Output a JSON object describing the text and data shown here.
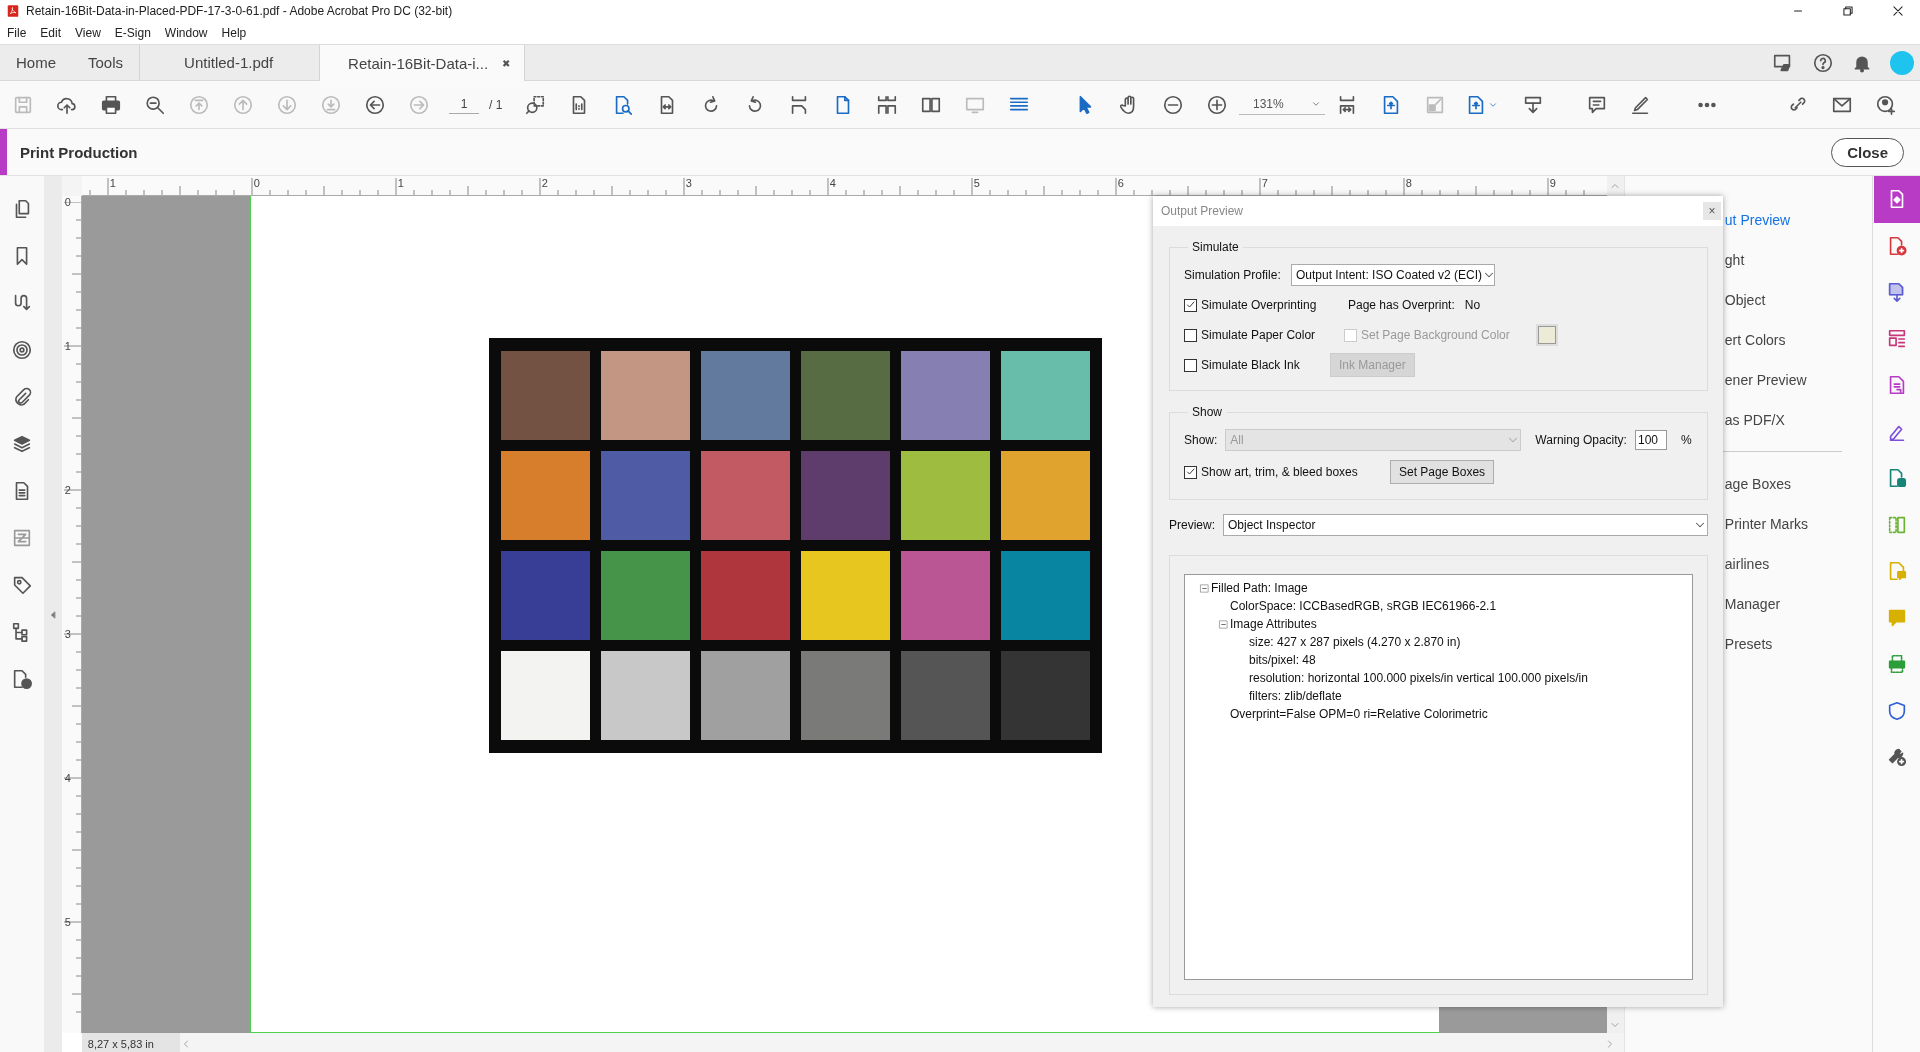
{
  "window": {
    "title": "Retain-16Bit-Data-in-Placed-PDF-17-3-0-61.pdf - Adobe Acrobat Pro DC (32-bit)"
  },
  "menu": [
    "File",
    "Edit",
    "View",
    "E-Sign",
    "Window",
    "Help"
  ],
  "tabs": [
    {
      "label": "Home",
      "selected": false,
      "kind": "nav"
    },
    {
      "label": "Tools",
      "selected": false,
      "kind": "nav"
    },
    {
      "label": "Untitled-1.pdf",
      "selected": false,
      "kind": "doc"
    },
    {
      "label": "Retain-16Bit-Data-i...",
      "selected": true,
      "kind": "doc",
      "close": "✖"
    }
  ],
  "toolbar": {
    "page": "1",
    "page_total": "/ 1",
    "zoom": "131%"
  },
  "tool_header": {
    "title": "Print Production",
    "close": "Close"
  },
  "rulers": {
    "horizontal": [
      "1",
      "0",
      "1",
      "2",
      "3",
      "4",
      "5",
      "6",
      "7",
      "8",
      "9"
    ],
    "vertical": [
      "0",
      "1",
      "2",
      "3",
      "4",
      "5"
    ]
  },
  "document": {
    "size": "8,27 x 5,83 in",
    "patches": [
      {
        "color": "#735244"
      },
      {
        "color": "#c29682"
      },
      {
        "color": "#627a9d"
      },
      {
        "color": "#576c43"
      },
      {
        "color": "#8580b1"
      },
      {
        "color": "#67bdaa"
      },
      {
        "color": "#d67e2c"
      },
      {
        "color": "#505ba6"
      },
      {
        "color": "#c15a63"
      },
      {
        "color": "#5e3c6c"
      },
      {
        "color": "#9dbc40"
      },
      {
        "color": "#e0a32e"
      },
      {
        "color": "#383d96"
      },
      {
        "color": "#469449"
      },
      {
        "color": "#af363c"
      },
      {
        "color": "#e7c71f"
      },
      {
        "color": "#bb5695"
      },
      {
        "color": "#0885a1"
      },
      {
        "color": "#f3f3f2"
      },
      {
        "color": "#c8c8c8"
      },
      {
        "color": "#a0a0a0"
      },
      {
        "color": "#7a7a79"
      },
      {
        "color": "#555555"
      },
      {
        "color": "#343434"
      }
    ]
  },
  "output_preview": {
    "title": "Output Preview",
    "close": "×",
    "simulate": {
      "legend": "Simulate",
      "profile_label": "Simulation Profile:",
      "profile": "Output Intent: ISO Coated v2 (ECI)",
      "overprinting": {
        "label": "Simulate Overprinting",
        "checked": true
      },
      "overprint_label": "Page has Overprint:",
      "overprint_value": "No",
      "paper_color": {
        "label": "Simulate Paper Color",
        "checked": false
      },
      "background_color": {
        "label": "Set Page Background Color",
        "checked": false,
        "disabled": true
      },
      "black_ink": {
        "label": "Simulate Black Ink",
        "checked": false
      },
      "ink_manager": {
        "label": "Ink Manager",
        "disabled": true
      }
    },
    "show": {
      "legend": "Show",
      "show_label": "Show:",
      "show_value": "All",
      "show_disabled": true,
      "opacity_label": "Warning Opacity:",
      "opacity": "100",
      "percent": "%",
      "boxes": {
        "label": "Show art, trim, & bleed boxes",
        "checked": true
      },
      "set_boxes": {
        "label": "Set Page Boxes",
        "disabled": false
      }
    },
    "preview_label": "Preview:",
    "preview": "Object Inspector",
    "tree": [
      {
        "label": "Filled Path: Image",
        "expanded": true,
        "children": [
          {
            "label": "ColorSpace: ICCBasedRGB, sRGB IEC61966-2.1"
          },
          {
            "label": "Image Attributes",
            "expanded": true,
            "children": [
              {
                "label": "size: 427 x 287 pixels (4.270 x 2.870 in)"
              },
              {
                "label": "bits/pixel: 48"
              },
              {
                "label": "resolution: horizontal 100.000 pixels/in vertical 100.000 pixels/in"
              },
              {
                "label": "filters: zlib/deflate"
              }
            ]
          },
          {
            "label": "Overprint=False OPM=0 ri=Relative Colorimetric"
          }
        ]
      }
    ]
  },
  "tool_panel": {
    "groups": [
      {
        "items": [
          {
            "label": "ut Preview",
            "selected": true
          },
          {
            "label": "ght",
            "selected": false
          },
          {
            "label": "Object",
            "selected": false
          },
          {
            "label": "ert Colors",
            "selected": false
          },
          {
            "label": "ener Preview",
            "selected": false
          },
          {
            "label": "as PDF/X",
            "selected": false
          }
        ]
      },
      {
        "items": [
          {
            "label": "age Boxes",
            "selected": false
          },
          {
            "label": "Printer Marks",
            "selected": false
          },
          {
            "label": "airlines",
            "selected": false
          },
          {
            "label": "Manager",
            "selected": false
          },
          {
            "label": "Presets",
            "selected": false
          }
        ]
      }
    ]
  }
}
